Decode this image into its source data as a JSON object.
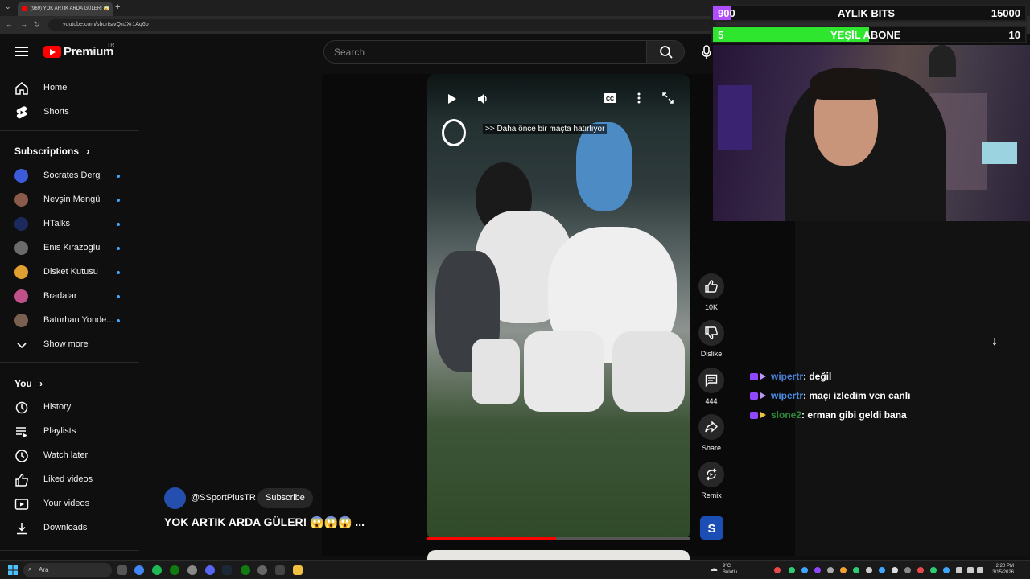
{
  "browser": {
    "tab_title": "(969) YOK ARTIK ARDA GÜLER! 😱",
    "url": "youtube.com/shorts/vQnJXr1Aq6o"
  },
  "masthead": {
    "logo_text": "Premium",
    "country_code": "TR",
    "search_placeholder": "Search"
  },
  "sidebar": {
    "main": [
      {
        "label": "Home",
        "icon": "home-icon"
      },
      {
        "label": "Shorts",
        "icon": "shorts-icon"
      }
    ],
    "subscriptions_heading": "Subscriptions",
    "subscriptions": [
      {
        "label": "Socrates Dergi",
        "color": "#3b5bdb"
      },
      {
        "label": "Nevşin Mengü",
        "color": "#8a5a4a"
      },
      {
        "label": "HTalks",
        "color": "#1b2a5c"
      },
      {
        "label": "Enis Kirazoglu",
        "color": "#6b6b6b"
      },
      {
        "label": "Disket Kutusu",
        "color": "#e0a030"
      },
      {
        "label": "Bradalar",
        "color": "#c0508a"
      },
      {
        "label": "Baturhan Yonde...",
        "color": "#7a6050"
      }
    ],
    "show_more": "Show more",
    "you_heading": "You",
    "you": [
      {
        "label": "History",
        "icon": "history-icon"
      },
      {
        "label": "Playlists",
        "icon": "playlists-icon"
      },
      {
        "label": "Watch later",
        "icon": "watch-later-icon"
      },
      {
        "label": "Liked videos",
        "icon": "liked-videos-icon"
      },
      {
        "label": "Your videos",
        "icon": "your-videos-icon"
      },
      {
        "label": "Downloads",
        "icon": "downloads-icon"
      }
    ]
  },
  "short": {
    "caption": ">> Daha önce bir maçta hatırlıyor",
    "progress": 0.49,
    "channel": "@SSportPlusTR",
    "subscribe": "Subscribe",
    "title": "YOK ARTIK ARDA GÜLER! 😱😱😱 ...",
    "actions": {
      "likes": "10K",
      "dislike": "Dislike",
      "comments": "444",
      "share": "Share",
      "remix": "Remix"
    }
  },
  "overlay": {
    "bits_bar": {
      "left": "900",
      "label": "AYLIK BITS",
      "right": "15000",
      "fill": 0.06,
      "color": "#b14cff"
    },
    "sub_bar": {
      "left": "5",
      "label": "YEŞİL ABONE",
      "right": "10",
      "fill": 0.5,
      "color": "#2ee62e"
    },
    "chat": [
      {
        "user": "wipertr",
        "user_color": "#4a7fd6",
        "message": ": değil"
      },
      {
        "user": "wipertr",
        "user_color": "#4a8fe6",
        "message": ": maçı izledim ven canlı"
      },
      {
        "user": "slone2",
        "user_color": "#2e8b3a",
        "message": ": erman gibi geldi bana"
      }
    ]
  },
  "taskbar": {
    "search": "Ara",
    "weather_temp": "9°C",
    "weather_text": "Bulutlu",
    "time": "2:20 PM",
    "date": "3/15/2026"
  }
}
